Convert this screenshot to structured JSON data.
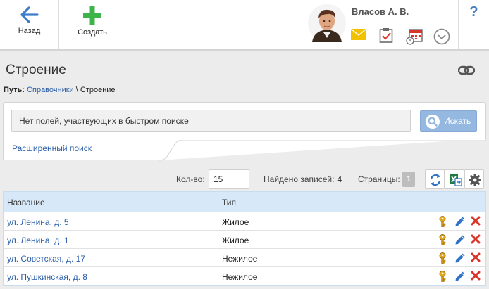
{
  "toolbar": {
    "back_label": "Назад",
    "create_label": "Создать",
    "help_label": "?"
  },
  "user": {
    "name": "Власов А. В."
  },
  "page": {
    "title": "Строение",
    "path_label": "Путь:",
    "path_link": "Справочники",
    "path_separator": "\\",
    "path_current": "Строение"
  },
  "search": {
    "placeholder": "Нет полей, участвующих в быстром поиске",
    "button_label": "Искать",
    "advanced_link": "Расширенный поиск"
  },
  "pager": {
    "count_label": "Кол-во:",
    "count_value": "15",
    "found_label": "Найдено записей:",
    "found_value": "4",
    "pages_label": "Страницы:",
    "current_page": "1"
  },
  "table": {
    "columns": [
      "Название",
      "Тип"
    ],
    "rows": [
      {
        "name": "ул. Ленина, д. 5",
        "type": "Жилое"
      },
      {
        "name": "ул. Ленина, д. 1",
        "type": "Жилое"
      },
      {
        "name": "ул. Советская, д. 17",
        "type": "Нежилое"
      },
      {
        "name": "ул. Пушкинская, д. 8",
        "type": "Нежилое"
      }
    ]
  },
  "colors": {
    "accent_blue": "#2a5ea8",
    "create_green": "#3cb44a",
    "search_button": "#94b8e0",
    "table_header": "#d7e8f8",
    "delete_red": "#d9352a",
    "mail_yellow": "#f2c200"
  },
  "icons": {
    "back": "arrow-left-icon",
    "create": "plus-icon",
    "mail": "mail-icon",
    "tasks": "clipboard-check-icon",
    "calendar": "calendar-clock-icon",
    "more": "chevron-circle-down-icon",
    "link": "chain-link-icon",
    "search": "magnifier-icon",
    "refresh": "refresh-icon",
    "export": "excel-export-icon",
    "settings": "gear-icon",
    "key": "key-icon",
    "edit": "pencil-icon",
    "delete": "close-icon"
  }
}
